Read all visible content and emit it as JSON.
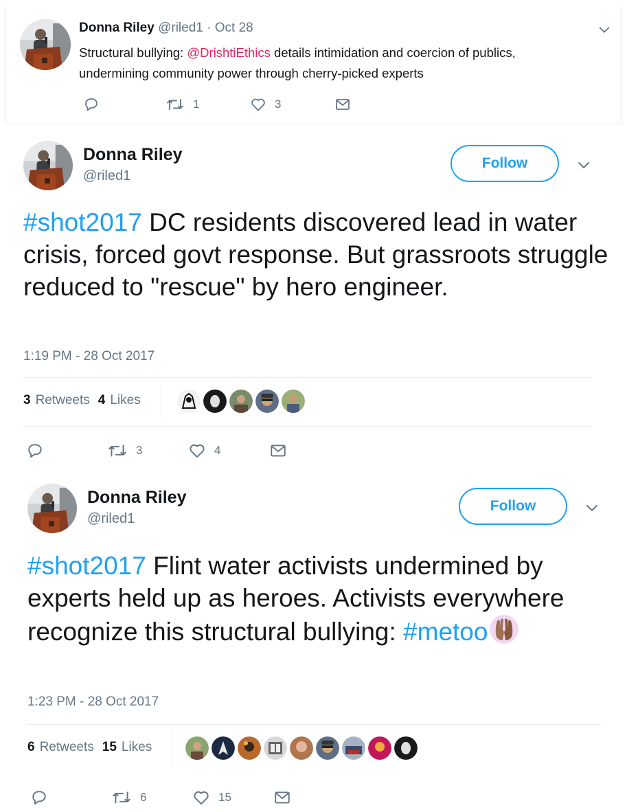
{
  "tweet_top": {
    "author_name": "Donna Riley",
    "handle": "@riled1",
    "separator": "·",
    "date": "Oct 28",
    "text_before": "Structural bullying: ",
    "mention": "@DrishtiEthics",
    "text_after": " details intimidation and coercion of publics, undermining community power through cherry-picked experts",
    "replies": "",
    "retweets": "1",
    "likes": "3"
  },
  "tweet_a": {
    "author_name": "Donna Riley",
    "handle": "@riled1",
    "follow_label": "Follow",
    "hashtag": "#shot2017",
    "text": " DC residents discovered lead in water crisis, forced govt response. But grassroots struggle reduced to \"rescue\" by hero engineer.",
    "timestamp": "1:19 PM - 28 Oct 2017",
    "retweet_count": "3",
    "retweet_label": "Retweets",
    "like_count": "4",
    "like_label": "Likes",
    "action_retweets": "3",
    "action_likes": "4"
  },
  "tweet_b": {
    "author_name": "Donna Riley",
    "handle": "@riled1",
    "follow_label": "Follow",
    "hashtag": "#shot2017",
    "text": " Flint water activists undermined by experts held up as heroes. Activists everywhere recognize this structural bullying: ",
    "hashtag2": "#metoo",
    "emoji": "raised-hands-emoji",
    "timestamp": "1:23 PM - 28 Oct 2017",
    "retweet_count": "6",
    "retweet_label": "Retweets",
    "like_count": "15",
    "like_label": "Likes",
    "action_retweets": "6",
    "action_likes": "15"
  },
  "icons": [
    "chevron-down-icon",
    "reply-icon",
    "retweet-icon",
    "like-icon",
    "direct-message-icon"
  ],
  "colors": {
    "link": "#1da1f2",
    "mention": "#e0245e",
    "muted": "#657786",
    "text": "#14171a"
  }
}
